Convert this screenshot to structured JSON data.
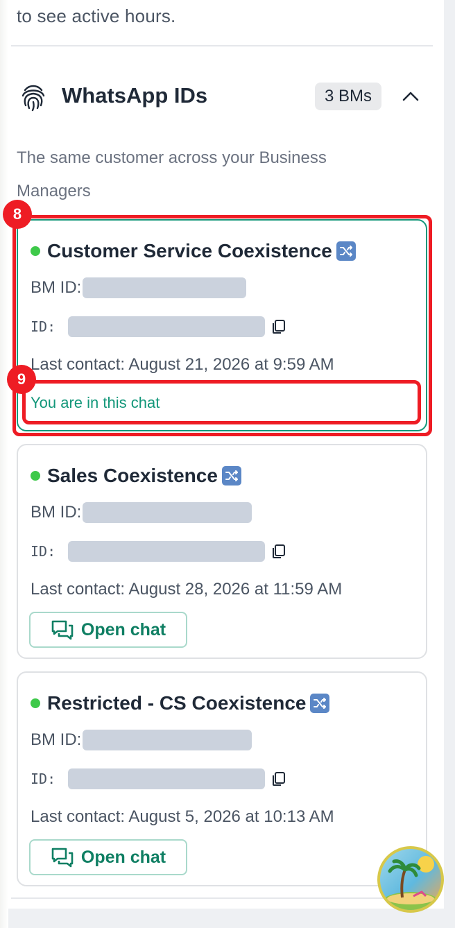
{
  "top_text": "to see active hours.",
  "section": {
    "title": "WhatsApp IDs",
    "badge": "3 BMs",
    "subtitle": "The same customer across your Business Managers"
  },
  "cards": [
    {
      "name": "Customer Service Coexistence",
      "bm_id_label": "BM ID:",
      "id_label": "ID:",
      "last_contact": "Last contact: August 21, 2026 at 9:59 AM",
      "status_text": "You are in this chat"
    },
    {
      "name": "Sales Coexistence",
      "bm_id_label": "BM ID:",
      "id_label": "ID:",
      "last_contact": "Last contact: August 28, 2026 at 11:59 AM",
      "button_label": "Open chat"
    },
    {
      "name": "Restricted - CS Coexistence",
      "bm_id_label": "BM ID:",
      "id_label": "ID:",
      "last_contact": "Last contact: August 5, 2026 at 10:13 AM",
      "button_label": "Open chat"
    }
  ],
  "markers": [
    "8",
    "9"
  ],
  "colors": {
    "accent_green": "#13977a",
    "online_dot": "#3ec94a",
    "highlight_red": "#ee1c24",
    "redaction": "#cbd2dd"
  },
  "icons": [
    "fingerprint-icon",
    "chevron-up-icon",
    "shuffle-icon",
    "copy-icon",
    "chat-bubbles-icon",
    "avatar"
  ]
}
